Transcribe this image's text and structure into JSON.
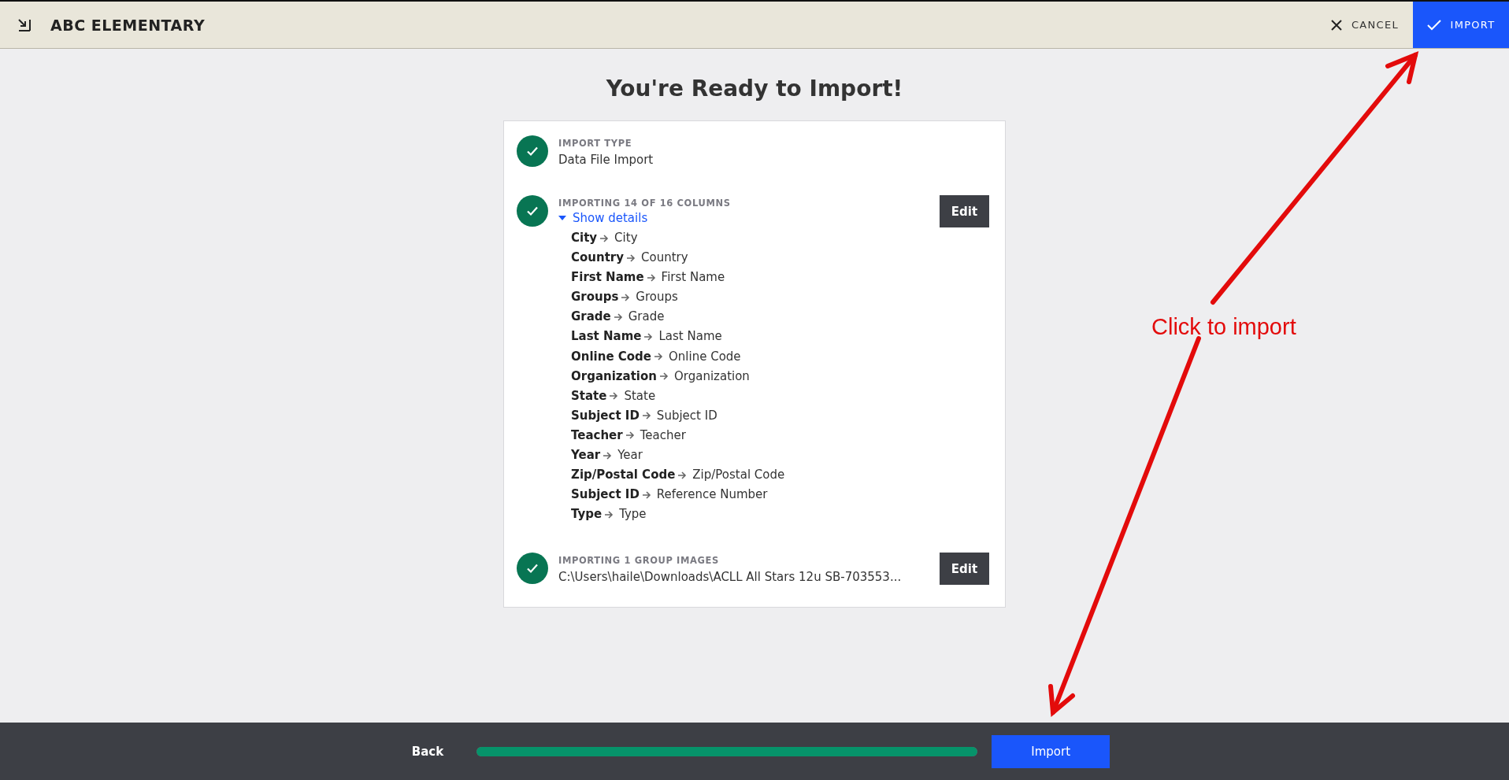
{
  "header": {
    "title": "ABC ELEMENTARY",
    "cancel": "CANCEL",
    "import": "IMPORT"
  },
  "heading": "You're Ready to Import!",
  "sections": [
    {
      "kind": "plain",
      "completed": true,
      "label": "IMPORT TYPE",
      "value": "Data File Import"
    },
    {
      "kind": "mapping",
      "completed": true,
      "label": "IMPORTING 14 OF 16 COLUMNS",
      "edit": "Edit",
      "details": {
        "label": "Show details",
        "expanded": true
      },
      "mappings": [
        {
          "source": "City",
          "target": "City"
        },
        {
          "source": "Country",
          "target": "Country"
        },
        {
          "source": "First Name",
          "target": "First Name"
        },
        {
          "source": "Groups",
          "target": "Groups"
        },
        {
          "source": "Grade",
          "target": "Grade"
        },
        {
          "source": "Last Name",
          "target": "Last Name"
        },
        {
          "source": "Online Code",
          "target": "Online Code"
        },
        {
          "source": "Organization",
          "target": "Organization"
        },
        {
          "source": "State",
          "target": "State"
        },
        {
          "source": "Subject ID",
          "target": "Subject ID"
        },
        {
          "source": "Teacher",
          "target": "Teacher"
        },
        {
          "source": "Year",
          "target": "Year"
        },
        {
          "source": "Zip/Postal Code",
          "target": "Zip/Postal Code"
        },
        {
          "source": "Subject ID",
          "target": "Reference Number"
        },
        {
          "source": "Type",
          "target": "Type"
        }
      ]
    },
    {
      "kind": "plain",
      "completed": true,
      "label": "IMPORTING 1 GROUP IMAGES",
      "value": "C:\\Users\\haile\\Downloads\\ACLL All Stars 12u SB-703553...",
      "edit": "Edit"
    }
  ],
  "footer": {
    "back": "Back",
    "level": 1,
    "import": "Import"
  },
  "annotation": {
    "text": "Click to import"
  }
}
